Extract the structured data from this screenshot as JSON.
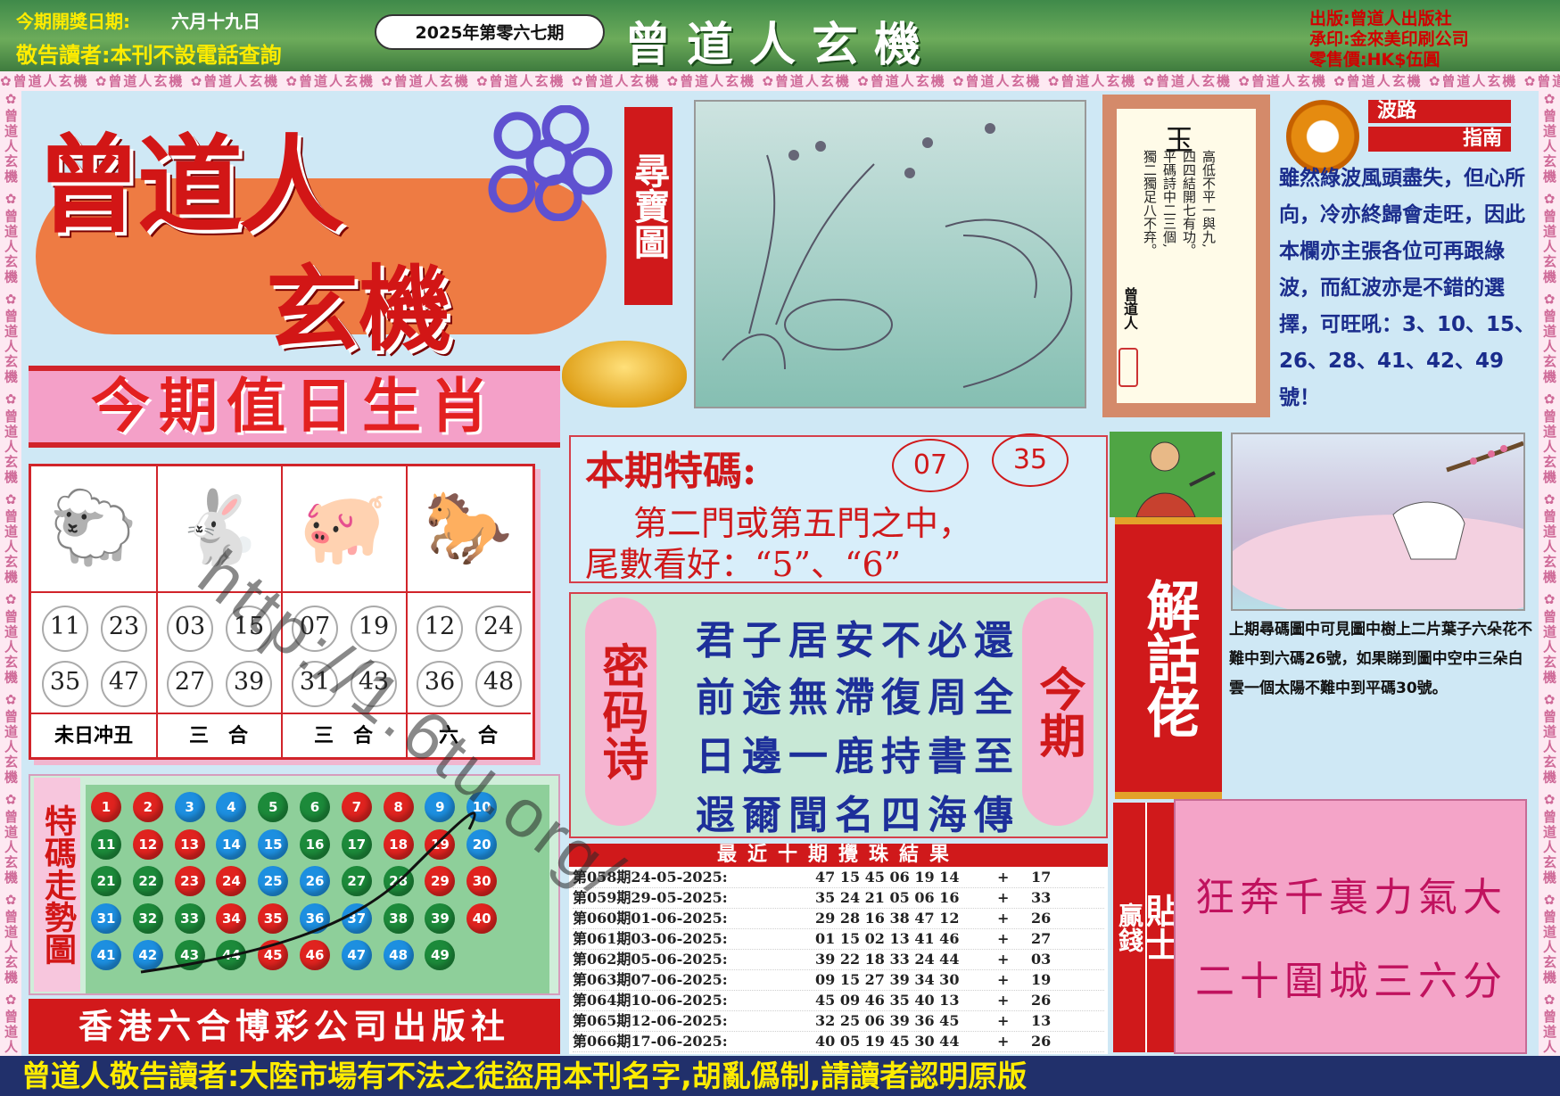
{
  "header": {
    "draw_date_label": "今期開獎日期:",
    "draw_date": "六月十九日",
    "notice": "敬告讀者:本刊不設電話查詢",
    "issue": "2025年第零六七期",
    "masthead": "曾道人玄機",
    "publisher_lines": [
      "出版:曾道人出版社",
      "承印:金來美印刷公司",
      "零售價:HK$伍圓"
    ]
  },
  "banner_repeat": "曾道人玄機",
  "logo": {
    "line1": "曾道人",
    "line2": "玄機"
  },
  "treasure_map_label": "尋寶圖",
  "zodiac": {
    "title": "今期值日生肖",
    "columns": [
      {
        "animal": "sheep",
        "numbers": [
          "11",
          "23",
          "35",
          "47"
        ],
        "caption": "未日冲丑"
      },
      {
        "animal": "rabbit",
        "numbers": [
          "03",
          "15",
          "27",
          "39"
        ],
        "caption": "三　合"
      },
      {
        "animal": "pig",
        "numbers": [
          "07",
          "19",
          "31",
          "43"
        ],
        "caption": "三　合"
      },
      {
        "animal": "horse",
        "numbers": [
          "12",
          "24",
          "36",
          "48"
        ],
        "caption": "六　合"
      }
    ]
  },
  "trend": {
    "label": "特碼走勢圖",
    "balls": [
      {
        "n": "1",
        "c": "red"
      },
      {
        "n": "2",
        "c": "red"
      },
      {
        "n": "3",
        "c": "blue"
      },
      {
        "n": "4",
        "c": "blue"
      },
      {
        "n": "5",
        "c": "green"
      },
      {
        "n": "6",
        "c": "green"
      },
      {
        "n": "7",
        "c": "red"
      },
      {
        "n": "8",
        "c": "red"
      },
      {
        "n": "9",
        "c": "blue"
      },
      {
        "n": "10",
        "c": "blue"
      },
      {
        "n": "11",
        "c": "green"
      },
      {
        "n": "12",
        "c": "red"
      },
      {
        "n": "13",
        "c": "red"
      },
      {
        "n": "14",
        "c": "blue"
      },
      {
        "n": "15",
        "c": "blue"
      },
      {
        "n": "16",
        "c": "green"
      },
      {
        "n": "17",
        "c": "green"
      },
      {
        "n": "18",
        "c": "red"
      },
      {
        "n": "19",
        "c": "red"
      },
      {
        "n": "20",
        "c": "blue"
      },
      {
        "n": "21",
        "c": "green"
      },
      {
        "n": "22",
        "c": "green"
      },
      {
        "n": "23",
        "c": "red"
      },
      {
        "n": "24",
        "c": "red"
      },
      {
        "n": "25",
        "c": "blue"
      },
      {
        "n": "26",
        "c": "blue"
      },
      {
        "n": "27",
        "c": "green"
      },
      {
        "n": "28",
        "c": "green"
      },
      {
        "n": "29",
        "c": "red"
      },
      {
        "n": "30",
        "c": "red"
      },
      {
        "n": "31",
        "c": "blue"
      },
      {
        "n": "32",
        "c": "green"
      },
      {
        "n": "33",
        "c": "green"
      },
      {
        "n": "34",
        "c": "red"
      },
      {
        "n": "35",
        "c": "red"
      },
      {
        "n": "36",
        "c": "blue"
      },
      {
        "n": "37",
        "c": "blue"
      },
      {
        "n": "38",
        "c": "green"
      },
      {
        "n": "39",
        "c": "green"
      },
      {
        "n": "40",
        "c": "red"
      },
      {
        "n": "41",
        "c": "blue"
      },
      {
        "n": "42",
        "c": "blue"
      },
      {
        "n": "43",
        "c": "green"
      },
      {
        "n": "44",
        "c": "green"
      },
      {
        "n": "45",
        "c": "red"
      },
      {
        "n": "46",
        "c": "red"
      },
      {
        "n": "47",
        "c": "blue"
      },
      {
        "n": "48",
        "c": "blue"
      },
      {
        "n": "49",
        "c": "green"
      }
    ],
    "colors": {
      "red": "#e0231f",
      "blue": "#1d8fe0",
      "green": "#1c8a3a"
    }
  },
  "publisher_footer": "香港六合博彩公司出版社",
  "poem_panel": {
    "title": "玉",
    "lines": [
      "高低不平一與九,",
      "四四結開七有功。",
      "平碼詩中二三個,",
      "獨二獨足八不弃。"
    ],
    "author": "曾道人"
  },
  "guide": {
    "title_1": "波路",
    "title_2": "指南",
    "text": "雖然綠波風頭盡失，但心所向，冷亦終歸會走旺，因此本欄亦主張各位可再跟綠波，而紅波亦是不錯的選擇，可旺吼：3、10、15、26、28、41、42、49號！"
  },
  "special_code": {
    "title": "本期特碼:",
    "numbers": [
      "07",
      "35"
    ],
    "line1": "第二門或第五門之中，",
    "line2": "尾數看好：“5”、“6”"
  },
  "secret_poem": {
    "left_label": "密码诗",
    "right_label": "今期",
    "lines": [
      "君子居安不必還",
      "前途無滯復周全",
      "日邊一鹿持書至",
      "遐爾聞名四海傳"
    ]
  },
  "results": {
    "title": "最近十期攪珠結果",
    "rows": [
      {
        "period": "第058期24-05-2025:",
        "nums": "47 15 45 06 19 14",
        "special": "17"
      },
      {
        "period": "第059期29-05-2025:",
        "nums": "35 24 21 05 06 16",
        "special": "33"
      },
      {
        "period": "第060期01-06-2025:",
        "nums": "29 28 16 38 47 12",
        "special": "26"
      },
      {
        "period": "第061期03-06-2025:",
        "nums": "01 15 02 13 41 46",
        "special": "27"
      },
      {
        "period": "第062期05-06-2025:",
        "nums": "39 22 18 33 24 44",
        "special": "03"
      },
      {
        "period": "第063期07-06-2025:",
        "nums": "09 15 27 39 34 30",
        "special": "19"
      },
      {
        "period": "第064期10-06-2025:",
        "nums": "45 09 46 35 40 13",
        "special": "26"
      },
      {
        "period": "第065期12-06-2025:",
        "nums": "32 25 06 39 36 45",
        "special": "13"
      },
      {
        "period": "第066期17-06-2025:",
        "nums": "40 05 19 45 30 44",
        "special": "26"
      }
    ]
  },
  "jiehua": {
    "label": "解話佬",
    "text": "上期尋碼圖中可見圖中樹上二片葉子六朵花不難中到六碼26號，如果睇到圖中空中三朵白雲一個太陽不難中到平碼30號。"
  },
  "tip": {
    "left": "贏錢",
    "mid": "貼士",
    "line1": "狂奔千裏力氣大",
    "line2": "二十圍城三六分"
  },
  "footer": "曾道人敬告讀者:大陸市場有不法之徒盜用本刊名字,胡亂僞制,請讀者認明原版",
  "watermark": "http://1.6tu.org/"
}
